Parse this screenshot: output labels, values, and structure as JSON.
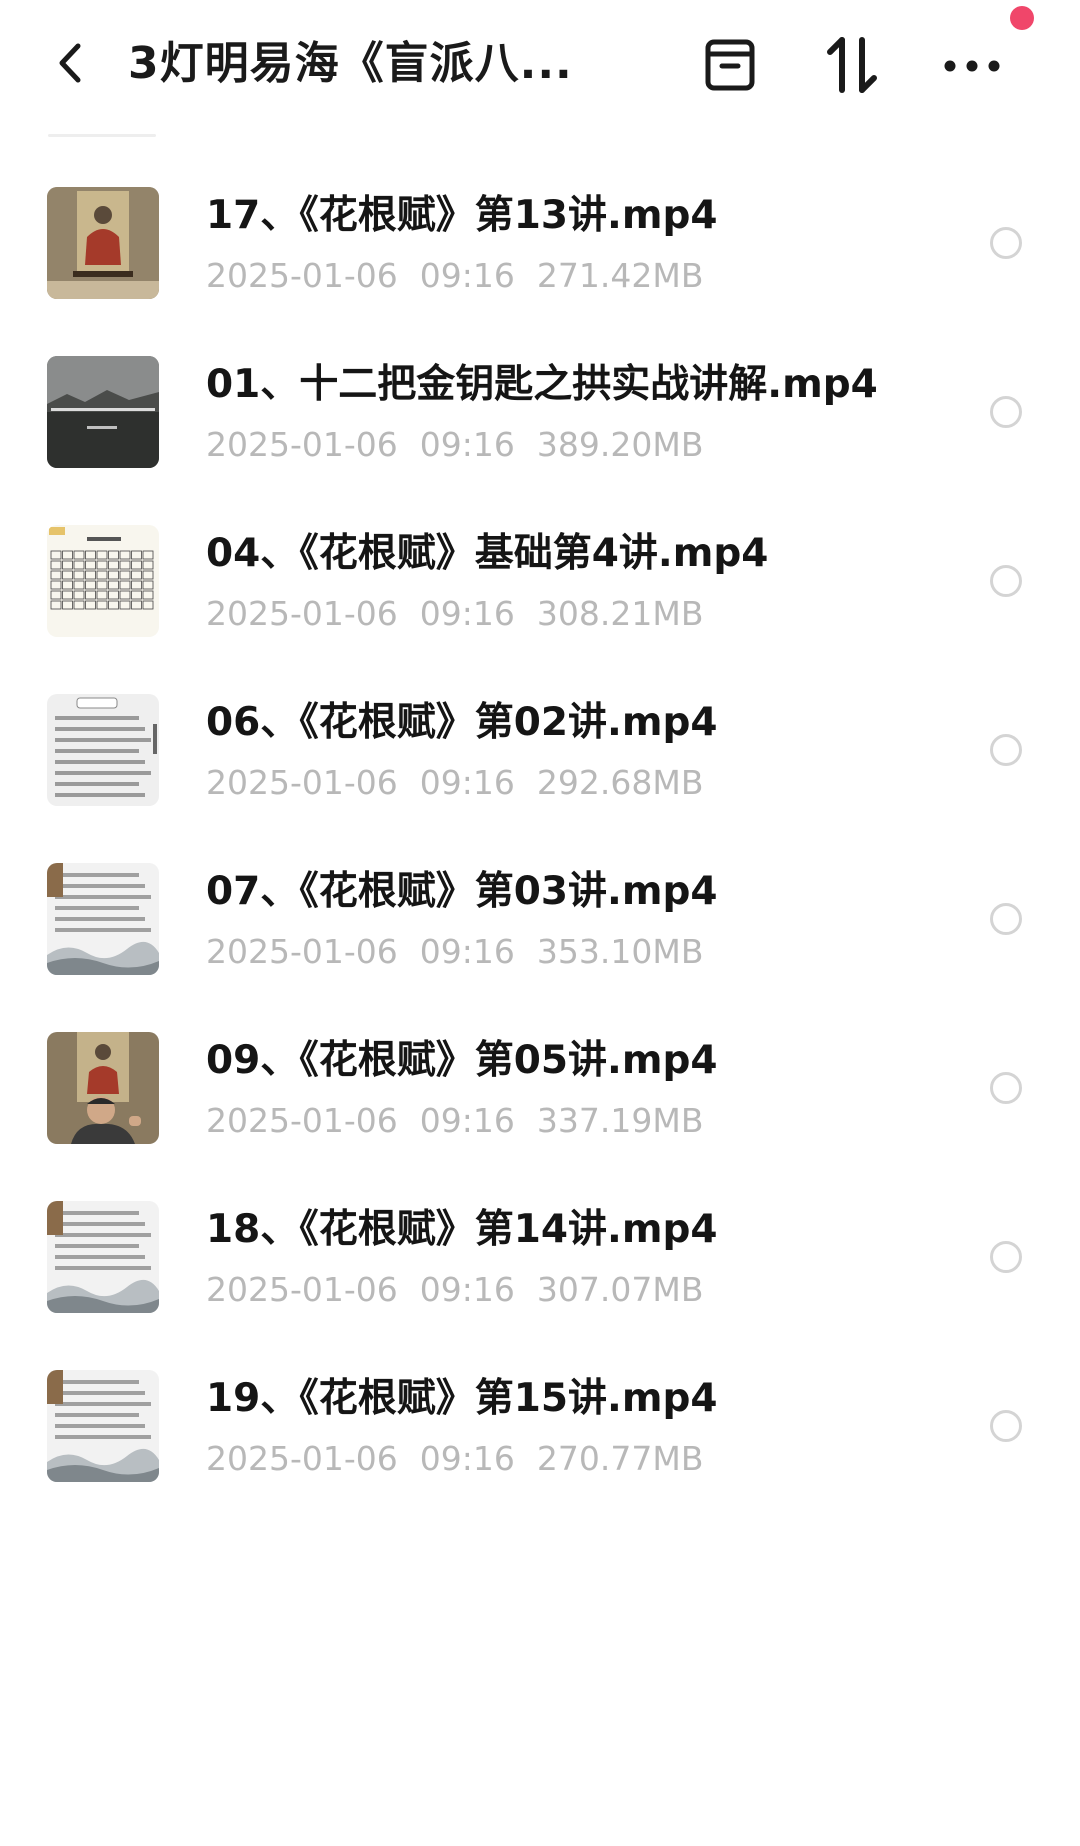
{
  "header": {
    "title": "3灯明易海《盲派八...",
    "back_icon": "chevron-left-icon",
    "archive_icon": "archive-box-icon",
    "sort_icon": "sort-arrows-icon",
    "more_icon": "more-dots-icon",
    "notify_color": "#f0466a"
  },
  "files": [
    {
      "name": "17、《花根赋》第13讲.mp4",
      "date": "2025-01-06",
      "time": "09:16",
      "size": "271.42MB",
      "thumb": "painting"
    },
    {
      "name": "01、十二把金钥匙之拱实战讲解.mp4",
      "date": "2025-01-06",
      "time": "09:16",
      "size": "389.20MB",
      "thumb": "landscape"
    },
    {
      "name": "04、《花根赋》基础第4讲.mp4",
      "date": "2025-01-06",
      "time": "09:16",
      "size": "308.21MB",
      "thumb": "table"
    },
    {
      "name": "06、《花根赋》第02讲.mp4",
      "date": "2025-01-06",
      "time": "09:16",
      "size": "292.68MB",
      "thumb": "text"
    },
    {
      "name": "07、《花根赋》第03讲.mp4",
      "date": "2025-01-06",
      "time": "09:16",
      "size": "353.10MB",
      "thumb": "text-wave"
    },
    {
      "name": "09、《花根赋》第05讲.mp4",
      "date": "2025-01-06",
      "time": "09:16",
      "size": "337.19MB",
      "thumb": "speaker"
    },
    {
      "name": "18、《花根赋》第14讲.mp4",
      "date": "2025-01-06",
      "time": "09:16",
      "size": "307.07MB",
      "thumb": "text-wave"
    },
    {
      "name": "19、《花根赋》第15讲.mp4",
      "date": "2025-01-06",
      "time": "09:16",
      "size": "270.77MB",
      "thumb": "text-wave"
    }
  ]
}
